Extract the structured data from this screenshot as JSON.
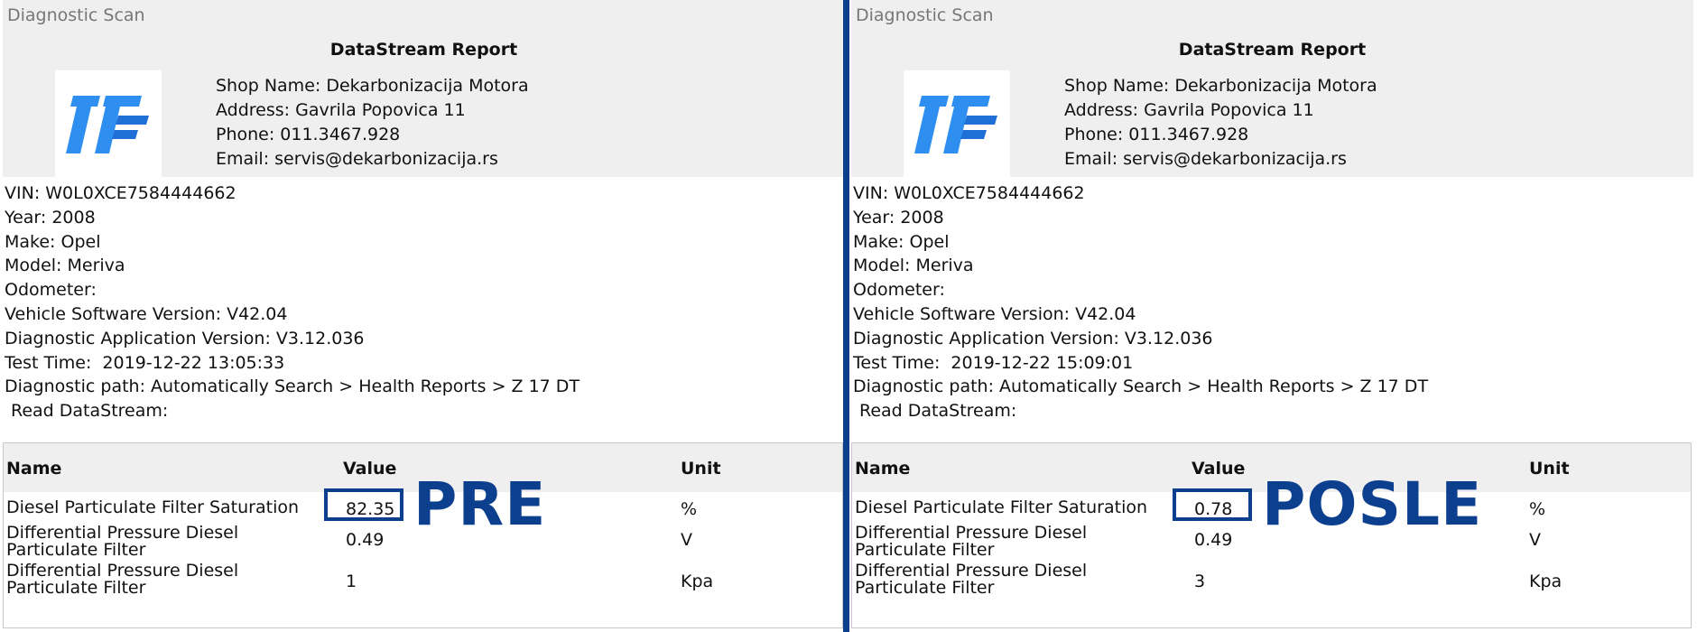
{
  "brand_color": "#0d3f8f",
  "logo": {
    "name": "shop-logo",
    "colors": [
      "#2e8ff0",
      "#1f6fd6"
    ]
  },
  "panels": [
    {
      "header": {
        "caption": "Diagnostic Scan",
        "title": "DataStream Report"
      },
      "shop": {
        "name": "Shop Name: Dekarbonizacija Motora",
        "address": "Address: Gavrila Popovica 11",
        "phone": "Phone: 011.3467.928",
        "email": "Email: servis@dekarbonizacija.rs"
      },
      "vehicle": {
        "vin": "VIN: W0L0XCE7584444662",
        "year": "Year: 2008",
        "make": "Make: Opel",
        "model": "Model: Meriva",
        "odometer": "Odometer:",
        "software": "Vehicle Software Version: V42.04",
        "application": "Diagnostic Application Version: V3.12.036",
        "test_time": "Test Time:  2019-12-22 13:05:33",
        "path": "Diagnostic path: Automatically Search > Health Reports > Z 17 DT",
        "read": "Read DataStream:"
      },
      "table": {
        "headers": {
          "name": "Name",
          "value": "Value",
          "unit": "Unit"
        },
        "rows": [
          {
            "name": "Diesel Particulate Filter Saturation",
            "value": "82.35",
            "unit": "%"
          },
          {
            "name": "Differential Pressure Diesel Particulate Filter",
            "value": "0.49",
            "unit": "V"
          },
          {
            "name": "Differential Pressure Diesel Particulate Filter",
            "value": "1",
            "unit": "Kpa"
          }
        ]
      },
      "overlay_label": "PRE"
    },
    {
      "header": {
        "caption": "Diagnostic Scan",
        "title": "DataStream Report"
      },
      "shop": {
        "name": "Shop Name: Dekarbonizacija Motora",
        "address": "Address: Gavrila Popovica 11",
        "phone": "Phone: 011.3467.928",
        "email": "Email: servis@dekarbonizacija.rs"
      },
      "vehicle": {
        "vin": "VIN: W0L0XCE7584444662",
        "year": "Year: 2008",
        "make": "Make: Opel",
        "model": "Model: Meriva",
        "odometer": "Odometer:",
        "software": "Vehicle Software Version: V42.04",
        "application": "Diagnostic Application Version: V3.12.036",
        "test_time": "Test Time:  2019-12-22 15:09:01",
        "path": "Diagnostic path: Automatically Search > Health Reports > Z 17 DT",
        "read": "Read DataStream:"
      },
      "table": {
        "headers": {
          "name": "Name",
          "value": "Value",
          "unit": "Unit"
        },
        "rows": [
          {
            "name": "Diesel Particulate Filter Saturation",
            "value": "0.78",
            "unit": "%"
          },
          {
            "name": "Differential Pressure Diesel Particulate Filter",
            "value": "0.49",
            "unit": "V"
          },
          {
            "name": "Differential Pressure Diesel Particulate Filter",
            "value": "3",
            "unit": "Kpa"
          }
        ]
      },
      "overlay_label": "POSLE"
    }
  ]
}
